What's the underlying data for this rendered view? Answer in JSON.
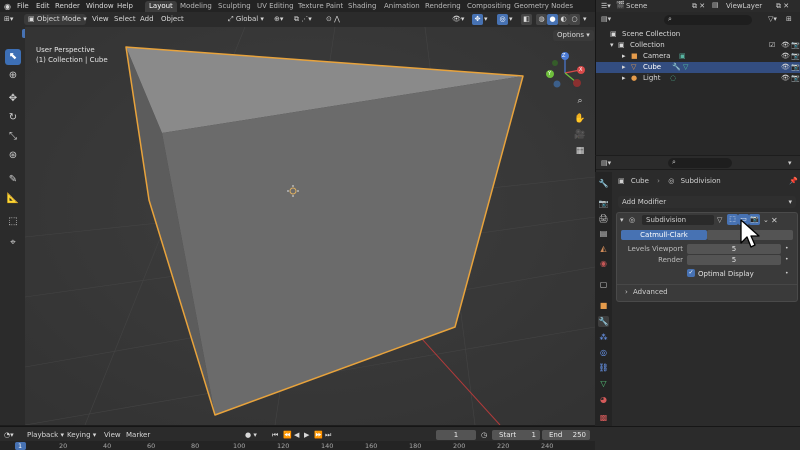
{
  "app": {
    "menus": [
      "File",
      "Edit",
      "Render",
      "Window",
      "Help"
    ],
    "workspaces": [
      "Layout",
      "Modeling",
      "Sculpting",
      "UV Editing",
      "Texture Paint",
      "Shading",
      "Animation",
      "Rendering",
      "Compositing",
      "Geometry Nodes"
    ],
    "active_workspace": "Layout",
    "scene_name": "Scene",
    "view_layer": "ViewLayer"
  },
  "viewport_header": {
    "mode": "Object Mode",
    "menus": [
      "View",
      "Select",
      "Add",
      "Object"
    ],
    "transform_orientation": "Global",
    "options": "Options"
  },
  "viewport": {
    "info_line1": "User Perspective",
    "info_line2": "(1) Collection | Cube",
    "gizmo": {
      "x": "X",
      "y": "Y",
      "z": "Z"
    },
    "accent_selected": "#e8a33c",
    "background": "#393939"
  },
  "outliner": {
    "rows": [
      {
        "label": "Scene Collection"
      },
      {
        "label": "Collection"
      },
      {
        "label": "Camera"
      },
      {
        "label": "Cube"
      },
      {
        "label": "Light"
      }
    ]
  },
  "properties": {
    "breadcrumb_object": "Cube",
    "breadcrumb_modifier": "Subdivision",
    "add_modifier": "Add Modifier",
    "modifier_name": "Subdivision",
    "mode_active": "Catmull-Clark",
    "mode_other": "Simple",
    "levels_viewport_label": "Levels Viewport",
    "levels_viewport_value": "5",
    "render_label": "Render",
    "render_value": "5",
    "optimal_display_label": "Optimal Display",
    "optimal_display_checked": true,
    "advanced_label": "Advanced"
  },
  "timeline": {
    "menus": [
      "Playback",
      "Keying",
      "View",
      "Marker"
    ],
    "current_frame": "1",
    "start_label": "Start",
    "start_value": "1",
    "end_label": "End",
    "end_value": "250",
    "ruler": [
      "1",
      "20",
      "40",
      "60",
      "80",
      "100",
      "120",
      "140",
      "160",
      "180",
      "200",
      "220",
      "240"
    ]
  }
}
